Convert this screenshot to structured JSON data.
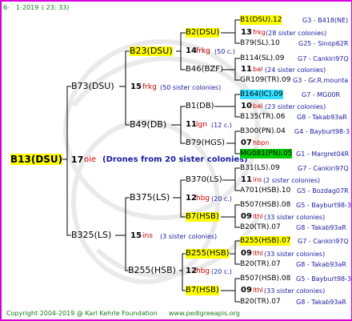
{
  "header": {
    "gen": "6-",
    "date": "1-2019",
    "time": "( 23: 33)"
  },
  "footer": {
    "copyright": "Copyright 2004-2019 @ Karl Kehrle Foundation",
    "url": "www.pedigreeapis.org"
  },
  "root": {
    "name": "B13(DSU)",
    "year": "17",
    "source": "oie",
    "note": "(Drones from 20 sister colonies)"
  },
  "gen1": {
    "top": {
      "name": "B73(DSU)",
      "year": "15",
      "source": "frkg",
      "sis": "(50 sister colonies)"
    },
    "bot": {
      "name": "B325(LS)",
      "year": "15",
      "source": "ins",
      "sis": "(3 sister colonies)"
    }
  },
  "gen2": {
    "a": {
      "name": "B23(DSU)",
      "year": "14",
      "source": "frkg",
      "sis": "(50 c.)"
    },
    "b": {
      "name": "B49(DB)",
      "year": "11",
      "source": "lgn",
      "sis": "(12 c.)"
    },
    "c": {
      "name": "B375(LS)",
      "year": "12",
      "source": "hbg",
      "sis": "(20 c.)"
    },
    "d": {
      "name": "B255(HSB)",
      "year": "12",
      "source": "hbg",
      "sis": "(20 c.)"
    }
  },
  "gen3": {
    "a": {
      "name": "B2(DSU)",
      "year": "13",
      "source": "frkg",
      "sis": "(28 sister colonies)"
    },
    "b": {
      "name": "B46(BZF)",
      "year": "11",
      "source": "bal",
      "sis": "(24 sister colonies)"
    },
    "c": {
      "name": "B1(DB)",
      "year": "10",
      "source": "bal",
      "sis": "(23 sister colonies)"
    },
    "d": {
      "name": "B79(HGS)",
      "year": "07",
      "source": "hbpn",
      "sis": ""
    },
    "e": {
      "name": "B370(LS)",
      "year": "11",
      "source": "ins",
      "sis": "(2 sister colonies)"
    },
    "f": {
      "name": "B7(HSB)",
      "year": "09",
      "source": "lthl",
      "sis": "(33 sister colonies)"
    },
    "g": {
      "name": "B255(HSB)",
      "year": "09",
      "source": "lthl",
      "sis": "(33 sister colonies)"
    },
    "h": {
      "name": "B7(HSB)",
      "year": "09",
      "source": "lthl",
      "sis": "(33 sister colonies)"
    }
  },
  "gen4": [
    {
      "name": "B1(DSU).12",
      "breed": "G3 - B418(NE)"
    },
    {
      "name": "B79(SL).10",
      "breed": "G25 - Sinop62R"
    },
    {
      "name": "B114(SL).09",
      "breed": "G7 - Cankiri97Q"
    },
    {
      "name": "GR109(TR).09",
      "breed": "G3 - Gr.R.mounta"
    },
    {
      "name": "B164(IC).09",
      "breed": "G7 - MG00R"
    },
    {
      "name": "B135(TR).06",
      "breed": "G8 - Takab93aR"
    },
    {
      "name": "B300(PN).04",
      "breed": "G4 - Bayburt98-3"
    },
    {
      "name": "MG081(PN).05",
      "breed": "G1 - Margret04R"
    },
    {
      "name": "B31(LS).09",
      "breed": "G7 - Cankiri97Q"
    },
    {
      "name": "A701(HSB).10",
      "breed": "G5 - Bozdag07R"
    },
    {
      "name": "B507(HSB).08",
      "breed": "G5 - Bayburt98-3"
    },
    {
      "name": "B20(TR).07",
      "breed": "G8 - Takab93aR"
    },
    {
      "name": "B255(HSB).07",
      "breed": "G7 - Cankiri97Q"
    },
    {
      "name": "B20(TR).07",
      "breed": "G8 - Takab93aR"
    },
    {
      "name": "B507(HSB).08",
      "breed": "G5 - Bayburt98-3"
    },
    {
      "name": "B20(TR).07",
      "breed": "G8 - Takab93aR"
    }
  ]
}
